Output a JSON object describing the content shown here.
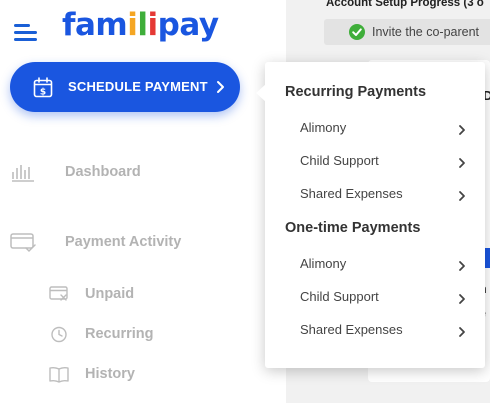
{
  "brand": {
    "logo_letters": [
      {
        "ch": "f",
        "color": "#1a56e0"
      },
      {
        "ch": "a",
        "color": "#1a56e0"
      },
      {
        "ch": "m",
        "color": "#1a56e0"
      },
      {
        "ch": "i",
        "color": "#f5a623"
      },
      {
        "ch": "l",
        "color": "#3fae3a"
      },
      {
        "ch": "i",
        "color": "#e53935"
      },
      {
        "ch": "p",
        "color": "#1a56e0"
      },
      {
        "ch": "a",
        "color": "#1a56e0"
      },
      {
        "ch": "y",
        "color": "#1a56e0"
      }
    ],
    "primary_color": "#1a56e0"
  },
  "sidebar": {
    "schedule_button": {
      "label": "SCHEDULE PAYMENT",
      "icon": "calendar-dollar-icon"
    },
    "nav": [
      {
        "label": "Dashboard",
        "icon": "bar-chart-icon"
      },
      {
        "label": "Payment Activity",
        "icon": "card-check-icon"
      }
    ],
    "sub_nav": [
      {
        "label": "Unpaid",
        "icon": "card-x-icon"
      },
      {
        "label": "Recurring",
        "icon": "clock-icon"
      },
      {
        "label": "History",
        "icon": "book-icon"
      }
    ]
  },
  "main": {
    "progress_title": "Account Setup Progress (3 o",
    "invite_step": {
      "label": "Invite the co-parent",
      "status": "complete",
      "icon": "check-circle-icon"
    },
    "fragments": [
      "D",
      "n",
      "e"
    ]
  },
  "dropdown": {
    "sections": [
      {
        "title": "Recurring Payments",
        "items": [
          "Alimony",
          "Child Support",
          "Shared Expenses"
        ]
      },
      {
        "title": "One-time Payments",
        "items": [
          "Alimony",
          "Child Support",
          "Shared Expenses"
        ]
      }
    ]
  }
}
